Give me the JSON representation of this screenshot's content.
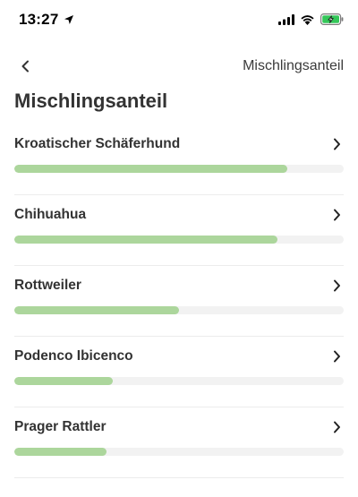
{
  "status_bar": {
    "time": "13:27"
  },
  "nav": {
    "title": "Mischlingsanteil"
  },
  "page": {
    "title": "Mischlingsanteil"
  },
  "colors": {
    "progress_fill": "#acd69c",
    "progress_track": "#f2f2f2",
    "battery_fill": "#34c759"
  },
  "icons": {
    "back": "chevron-left-icon",
    "row": "chevron-right-icon",
    "location": "location-arrow-icon",
    "signal": "cellular-signal-icon",
    "wifi": "wifi-icon",
    "battery": "battery-charging-icon"
  },
  "breeds": [
    {
      "name": "Kroatischer Schäferhund",
      "share": 0.83
    },
    {
      "name": "Chihuahua",
      "share": 0.8
    },
    {
      "name": "Rottweiler",
      "share": 0.5
    },
    {
      "name": "Podenco Ibicenco",
      "share": 0.3
    },
    {
      "name": "Prager Rattler",
      "share": 0.28
    }
  ]
}
